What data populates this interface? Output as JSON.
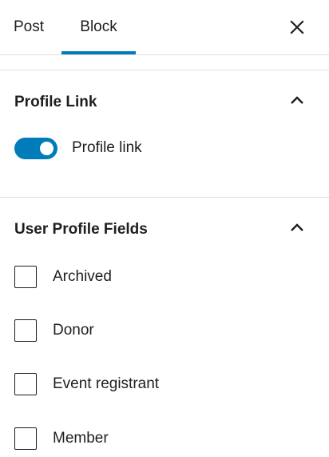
{
  "tabs": {
    "post_label": "Post",
    "block_label": "Block",
    "active": "Block"
  },
  "close_icon": "close-icon",
  "panels": {
    "profile_link": {
      "title": "Profile Link",
      "expanded": true,
      "toggle": {
        "label": "Profile link",
        "checked": true
      }
    },
    "user_profile_fields": {
      "title": "User Profile Fields",
      "expanded": true,
      "fields": [
        {
          "label": "Archived",
          "checked": false
        },
        {
          "label": "Donor",
          "checked": false
        },
        {
          "label": "Event registrant",
          "checked": false
        },
        {
          "label": "Member",
          "checked": false
        }
      ]
    }
  },
  "colors": {
    "accent": "#007cba",
    "text": "#1e1e1e",
    "border": "#e0e0e0"
  }
}
